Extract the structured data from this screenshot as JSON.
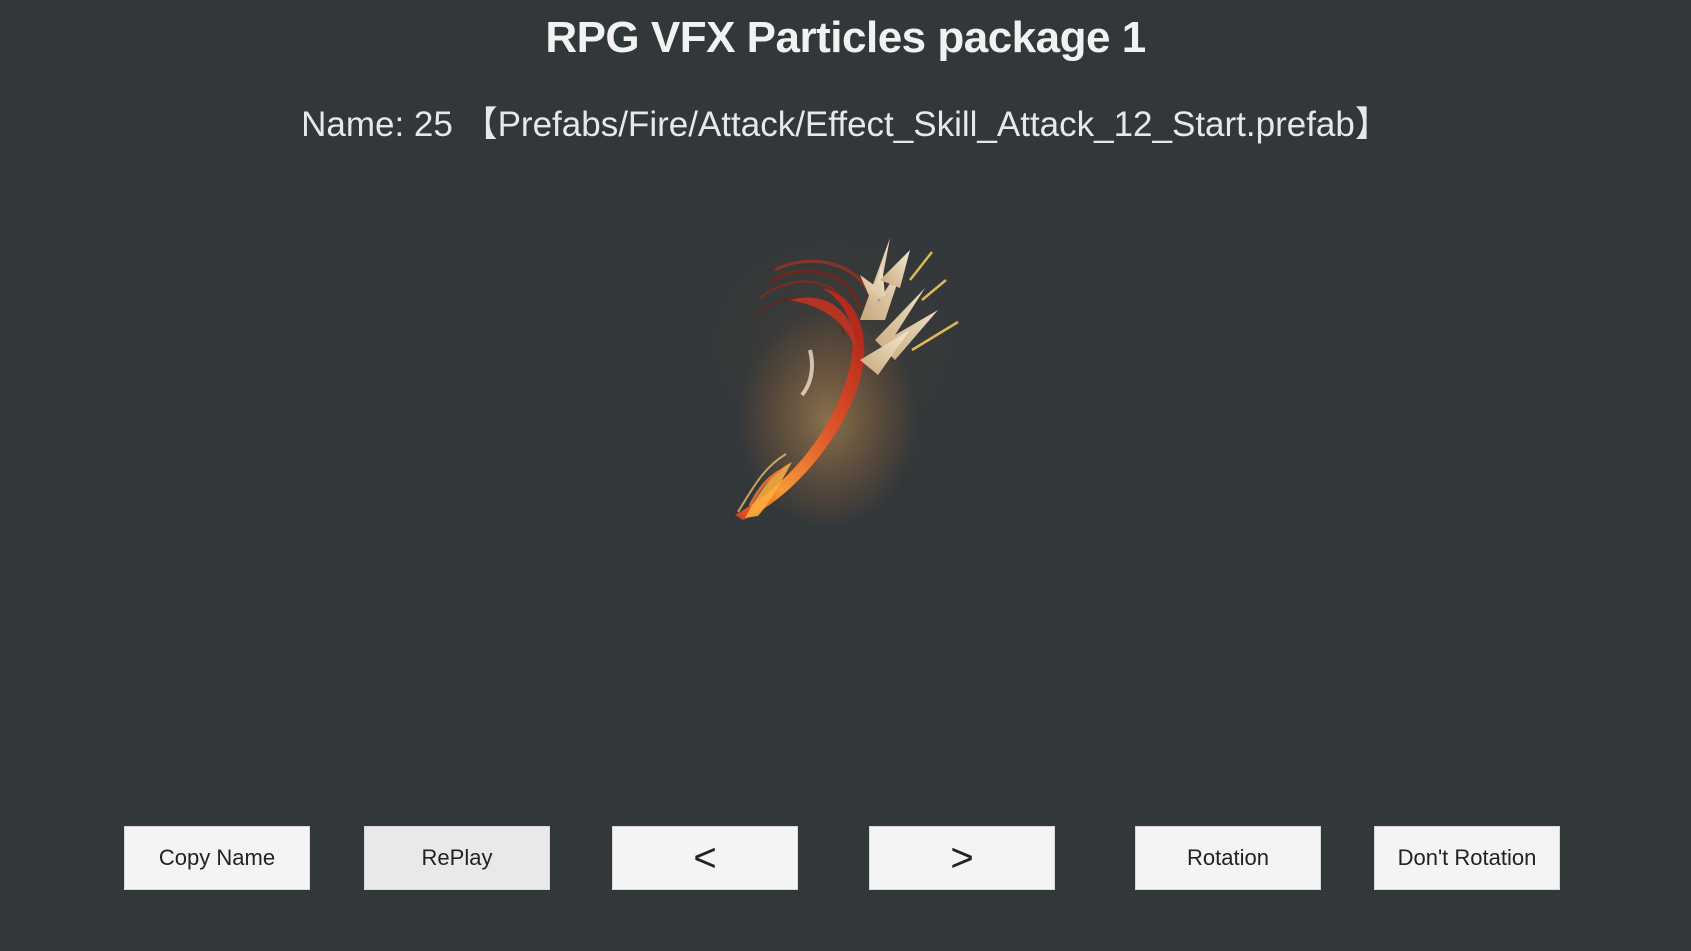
{
  "header": {
    "title": "RPG VFX Particles package 1",
    "name_line": "Name: 25 【Prefabs/Fire/Attack/Effect_Skill_Attack_12_Start.prefab】"
  },
  "effect": {
    "colors": {
      "background": "#32373a",
      "slash_red": "#c0321e",
      "slash_orange": "#f08a2a",
      "spark_cream": "#f1e2c0",
      "glow": "#ffb35a"
    }
  },
  "controls": {
    "copy_name": "Copy Name",
    "replay": "RePlay",
    "prev": "<",
    "next": ">",
    "rotation": "Rotation",
    "dont_rotation": "Don't Rotation"
  }
}
